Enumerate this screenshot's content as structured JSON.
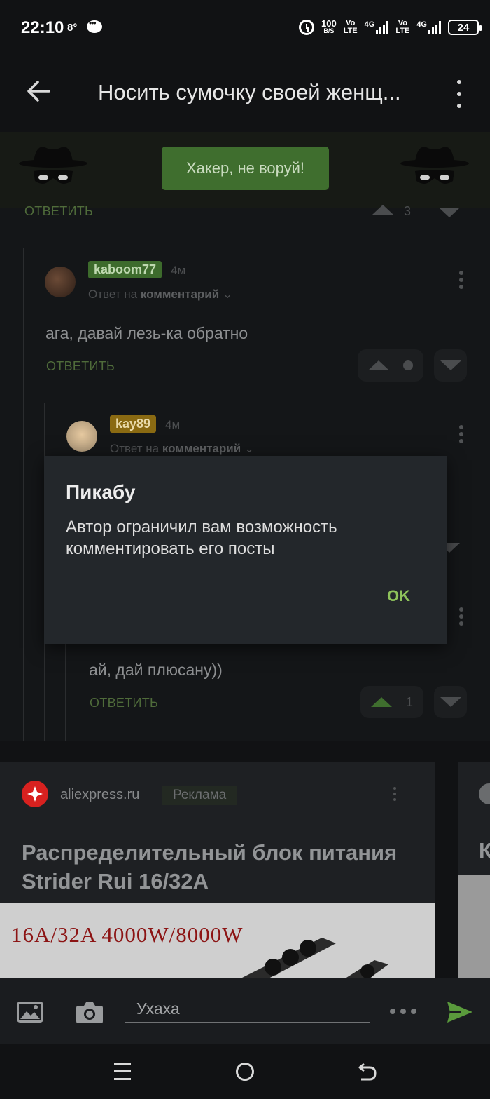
{
  "status_bar": {
    "time": "22:10",
    "temperature": "8°",
    "net_speed_value": "100",
    "net_speed_unit": "B/S",
    "sim1_label": "Vo",
    "sim1_sub": "LTE",
    "sim1_net": "4G",
    "sim2_label": "Vo",
    "sim2_sub": "LTE",
    "sim2_net": "4G",
    "battery": "24"
  },
  "app_bar": {
    "title": "Носить сумочку своей женщ..."
  },
  "banner": {
    "button_label": "Хакер, не воруй!"
  },
  "comments": [
    {
      "reply_label": "ОТВЕТИТЬ",
      "rating": "3"
    },
    {
      "username": "kaboom77",
      "username_color": "#3d6b2c",
      "time": "4м",
      "reply_to_prefix": "Ответ на",
      "reply_to_link": "комментарий",
      "text": "ага, давай лезь-ка обратно",
      "reply_label": "ОТВЕТИТЬ"
    },
    {
      "username": "kay89",
      "username_color": "#8a6a12",
      "time": "4м",
      "reply_to_prefix": "Ответ на",
      "reply_to_link": "комментарий"
    },
    {
      "text": "ай, дай плюсану))",
      "reply_label": "ОТВЕТИТЬ",
      "rating": "1"
    }
  ],
  "dialog": {
    "title": "Пикабу",
    "message": "Автор ограничил вам возможность комментировать его посты",
    "ok_label": "OK"
  },
  "ad": {
    "domain": "aliexpress.ru",
    "badge": "Реклама",
    "headline": "Распределительный блок питания Strider Rui 16/32A",
    "image_text": "16A/32A  4000W/8000W",
    "next_card_letter": "К"
  },
  "composer": {
    "input_value": "Ухаха",
    "accent_color": "#5a9a3c"
  },
  "nav_bar": {
    "icons": [
      "menu-icon",
      "home-icon",
      "back-icon"
    ]
  }
}
